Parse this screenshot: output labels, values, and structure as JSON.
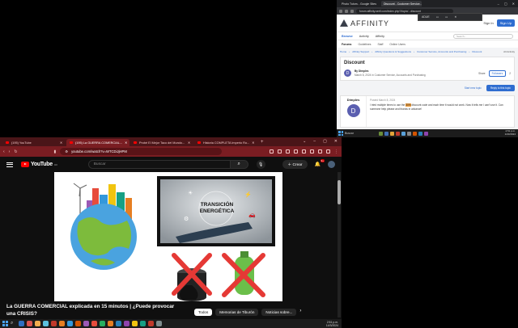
{
  "affinity_window": {
    "tabs": [
      "Photo Tutors - Google Sites",
      "Discount - Customer Service..."
    ],
    "url": "forum.affinity.serif.com/index.php?/topic/...discount",
    "popup": {
      "label": "ADUE",
      "icons": [
        "tab",
        "tab",
        "x"
      ]
    },
    "brand": "AFFINITY",
    "signin": "Sign In",
    "signup": "Sign Up",
    "nav": [
      "Browse",
      "Activity",
      "Affinity"
    ],
    "search_placeholder": "Search...",
    "subnav": [
      "Forums",
      "Guidelines",
      "Staff",
      "Online Users"
    ],
    "breadcrumb": [
      "Home",
      "Affinity Support",
      "Affinity Questions & Suggestions",
      "Customer Service, Accounts and Purchasing",
      "Discount"
    ],
    "all_activity": "All Activity",
    "topic_title": "Discount",
    "author_initial": "D",
    "author_by": "By Dimples",
    "author_date": "March 8, 2024 in Customer Service, Accounts and Purchasing",
    "share": "Share",
    "follow": "Followers",
    "follow_count": "2",
    "start_topic": "Start new topic",
    "reply_btn": "Reply to this topic",
    "post_author": "Dimples",
    "post_date": "Posted March 8, 2024",
    "post_text_before": "I tried multiple times to use the ",
    "post_text_highlight": "30%",
    "post_text_after": " discount code and each time it would not work. Now it tells me I can't use it. Can someone help please and thanks in advance!"
  },
  "top_taskbar": {
    "search": "Buscar",
    "clock_time": "2:51 p.m.",
    "clock_date": "14/3/2024"
  },
  "youtube_window": {
    "tabs": [
      {
        "label": "(195) YouTube",
        "active": false
      },
      {
        "label": "(195) La GUERRA COMERCIAL...",
        "active": true
      },
      {
        "label": "Probé El Mejor Taco del Mundo...",
        "active": false
      },
      {
        "label": "Historia COMPLETA Imperio Ro...",
        "active": false
      }
    ],
    "url": "youtube.com/watch?v=WTCDiJjHPM",
    "search_placeholder": "Buscar",
    "create": "Crear",
    "notif_count": "9+",
    "logo_region": "CO",
    "video_title": "La GUERRA COMERCIAL explicada en 15 minutos | ¿Puede provocar una CRISIS?",
    "chips": [
      "Todos",
      "Memorias de Tiburón",
      "Noticias sobre..."
    ],
    "slide_text_1": "TRANSICIÓN",
    "slide_text_2": "ENERGÉTICA"
  },
  "bottom_taskbar": {
    "clock_time": "2:51 p.m.",
    "clock_date": "14/3/2024"
  },
  "colors": {
    "youtube_tab_bar": "#4a1518",
    "youtube_toolbar": "#7a1d22",
    "affinity_blue": "#2f6dd0"
  }
}
